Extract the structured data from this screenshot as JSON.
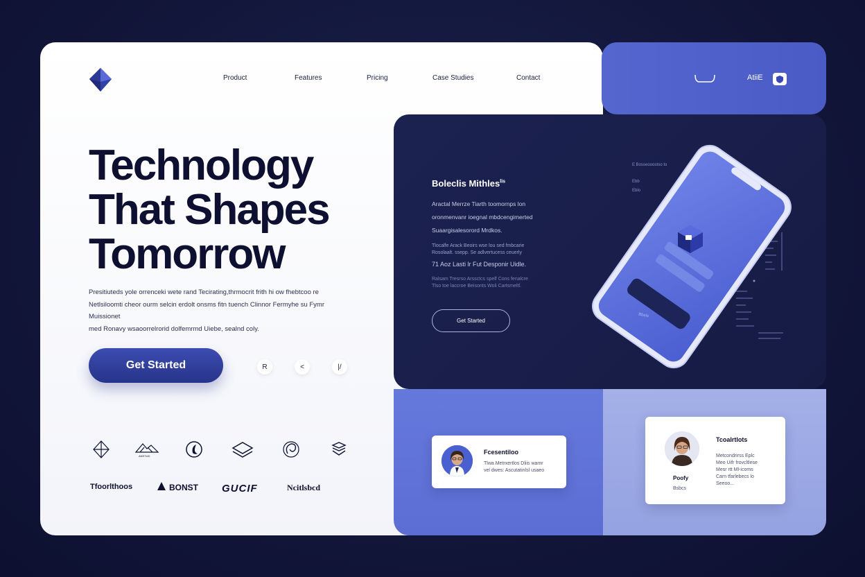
{
  "nav": {
    "items": [
      "Product",
      "Features",
      "Pricing",
      "Case Studies",
      "Contact"
    ],
    "right_label": "AtiiE"
  },
  "hero": {
    "title_lines": [
      "Technology",
      "That Shapes",
      "Tomorrow"
    ],
    "description_lines": [
      "Presitiuteds yole orrenceki wete rand Tecirating,thrmocrit frith hi ow fhebtcoo re",
      "Netlsiloomti cheor ourm selcin erdolt onsms fitn tuench Clinnor Fermyhe su Fymr Muissionet",
      "med Ronavy wsaoorrelrorid dolfemrmd Uiebe, sealnd coly."
    ],
    "cta_label": "Get Started",
    "mini_icons": [
      "R",
      "<",
      "|/"
    ]
  },
  "partners": {
    "icons": [
      "diamond-outline-icon",
      "mountain-logo-icon",
      "crescent-logo-icon",
      "layers-logo-icon",
      "swirl-logo-icon",
      "stack-logo-icon"
    ],
    "mountain_caption": "ANSTUD",
    "brands": [
      "Tfoorlthoos",
      "BONST",
      "GUCIF",
      "Ncitlsbcd"
    ]
  },
  "feature_panel": {
    "title": "Boleclis Mithles",
    "title_sup": "lis",
    "para_lines": [
      "Aractal Merrze Tiarth toomornps lon",
      "oronmenvanr ioegnal mbdcengimerted",
      "Suaargisalesorord Mrdkos."
    ],
    "small_lines": [
      "Tlocalfe Arack Beoirs wse lou sed fmbcarie",
      "Rosolaalt. ssepp. Se adlvertucess ceuerly"
    ],
    "mid_text": "71 Aoz Lasti lr Fut Desponir Uidle.",
    "small2_lines": [
      "Ralsam Tresrso Arssctcs spelf Cons fenalcre",
      "Tlso toe laccroe Beisonts Woli Cartsmeltl."
    ],
    "button_label": "Get Started",
    "side_labels": [
      "E Bosseooostoo to",
      "Ebb",
      "Eblo"
    ]
  },
  "phone": {
    "button_label": "Bbeis"
  },
  "testimonials": [
    {
      "name": "Fcesentiloo",
      "lines": [
        "Tlwa Metrxertlos Dliis wamr",
        "vel dwes: Ascutatinlsl usaeo"
      ]
    },
    {
      "name": "Tcoalrtlots",
      "role": "Poofy",
      "role2": "Bsbcs",
      "lines": [
        "Metcondrirss Eplc",
        "Meo Uifr frovcltlese",
        "Mesr rtt Ml-icoms",
        "Carn tfarlebecs lo",
        "Seeoo..."
      ]
    }
  ],
  "colors": {
    "brand_blue": "#4f60c9",
    "dark_navy": "#161b44",
    "cta_blue": "#2f3d9e",
    "light_blue": "#a4b0e7"
  }
}
